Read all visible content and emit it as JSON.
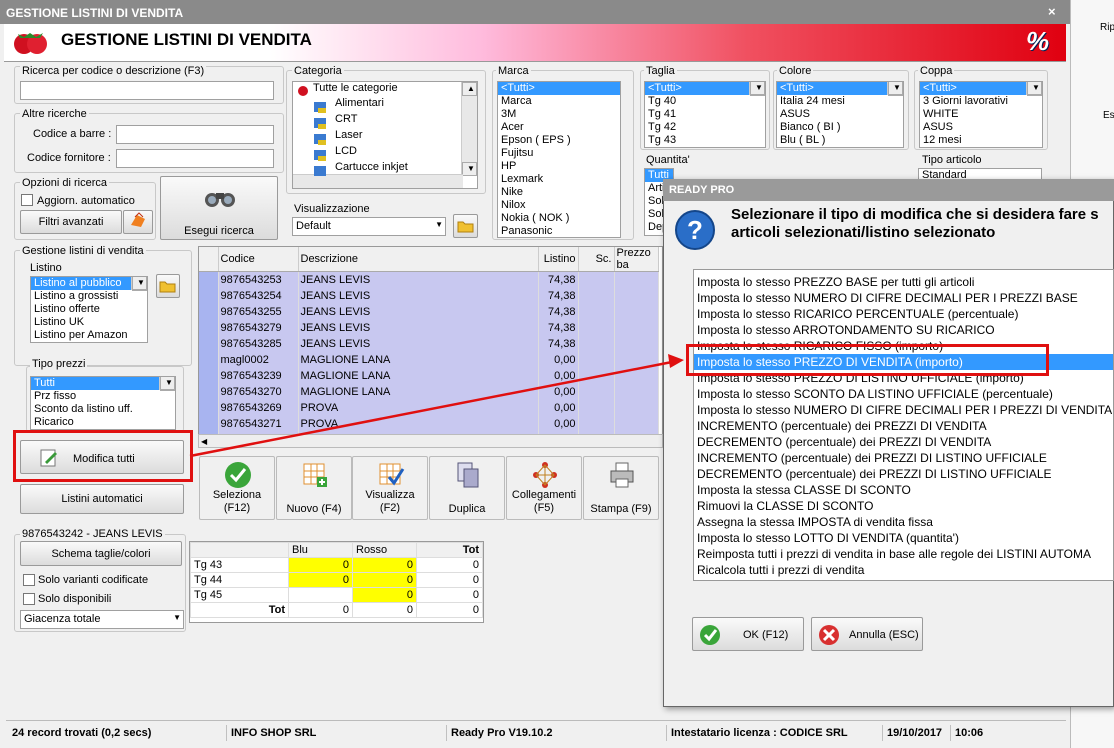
{
  "window": {
    "title": "GESTIONE LISTINI DI VENDITA",
    "banner_title": "GESTIONE LISTINI DI VENDITA",
    "banner_badge": "%",
    "close": "×"
  },
  "right_pane": {
    "text1": "Rip",
    "text2": "Es"
  },
  "search": {
    "label_code_desc": "Ricerca per codice o descrizione (F3)",
    "code_desc_value": "",
    "other_label": "Altre ricerche",
    "barcode_label": "Codice a barre :",
    "supplier_label": "Codice fornitore :",
    "options_label": "Opzioni di ricerca",
    "auto_update_label": "Aggiorn. automatico",
    "advanced_filters_label": "Filtri avanzati",
    "execute_label": "Esegui ricerca"
  },
  "category": {
    "label": "Categoria",
    "items": [
      "Tutte le categorie",
      "Alimentari",
      "CRT",
      "Laser",
      "LCD",
      "Cartucce inkjet"
    ]
  },
  "view": {
    "label": "Visualizzazione",
    "value": "Default"
  },
  "brand": {
    "label": "Marca",
    "items": [
      "<Tutti>",
      "Marca",
      "3M",
      "Acer",
      "Epson ( EPS )",
      "Fujitsu",
      "HP",
      "Lexmark",
      "Nike",
      "Nilox",
      "Nokia ( NOK )",
      "Panasonic"
    ]
  },
  "size": {
    "label": "Taglia",
    "items": [
      "<Tutti>",
      "Tg 40",
      "Tg 41",
      "Tg 42",
      "Tg 43"
    ]
  },
  "color": {
    "label": "Colore",
    "items": [
      "<Tutti>",
      "Italia 24 mesi",
      "ASUS",
      "Bianco ( BI )",
      "Blu ( BL )"
    ]
  },
  "cup": {
    "label": "Coppa",
    "items": [
      "<Tutti>",
      "3 Giorni lavorativi",
      "WHITE",
      "ASUS",
      "12 mesi"
    ]
  },
  "quantity": {
    "label": "Quantita'",
    "items": [
      "Tutti",
      "Arti",
      "Solo",
      "Solo",
      "Dep"
    ]
  },
  "article_type": {
    "label": "Tipo articolo",
    "value": "Standard"
  },
  "price_lists": {
    "group_label": "Gestione listini di vendita",
    "label": "Listino",
    "items": [
      "Listino al pubblico",
      "Listino a grossisti",
      "Listino offerte",
      "Listino UK",
      "Listino per Amazon"
    ]
  },
  "price_types": {
    "label": "Tipo prezzi",
    "items": [
      "Tutti",
      "Prz fisso",
      "Sconto da listino uff.",
      "Ricarico"
    ]
  },
  "modify_all_label": "Modifica tutti",
  "auto_lists_label": "Listini automatici",
  "grid": {
    "columns": [
      "Codice",
      "Descrizione",
      "Listino",
      "Sc.",
      "Prezzo ba"
    ],
    "rows": [
      [
        "9876543253",
        "JEANS LEVIS",
        "74,38"
      ],
      [
        "9876543254",
        "JEANS LEVIS",
        "74,38"
      ],
      [
        "9876543255",
        "JEANS LEVIS",
        "74,38"
      ],
      [
        "9876543279",
        "JEANS LEVIS",
        "74,38"
      ],
      [
        "9876543285",
        "JEANS LEVIS",
        "74,38"
      ],
      [
        "magl0002",
        "MAGLIONE LANA",
        "0,00"
      ],
      [
        "9876543239",
        "MAGLIONE LANA",
        "0,00"
      ],
      [
        "9876543270",
        "MAGLIONE LANA",
        "0,00"
      ],
      [
        "9876543269",
        "PROVA",
        "0,00"
      ],
      [
        "9876543271",
        "PROVA",
        "0,00"
      ],
      [
        "9876543272",
        "PROVA",
        "0,00"
      ]
    ]
  },
  "toolbar": {
    "select": "Seleziona",
    "select_key": "(F12)",
    "new": "Nuovo (F4)",
    "view": "Visualizza",
    "view_key": "(F2)",
    "duplicate": "Duplica",
    "links": "Collegamenti",
    "links_key": "(F5)",
    "print": "Stampa (F9)"
  },
  "variants": {
    "article_label": "9876543242 - JEANS LEVIS",
    "schema_label": "Schema taglie/colori",
    "only_coded": "Solo varianti codificate",
    "only_available": "Solo disponibili",
    "stock_value": "Giacenza totale",
    "headers": [
      "",
      "Blu",
      "Rosso",
      "Tot"
    ],
    "rows": [
      [
        "Tg 43",
        "0",
        "0",
        "0"
      ],
      [
        "Tg 44",
        "0",
        "0",
        "0"
      ],
      [
        "Tg 45",
        "",
        "0",
        "0"
      ],
      [
        "Tot",
        "0",
        "0",
        "0"
      ]
    ]
  },
  "status": {
    "records": "24 record trovati (0,2 secs)",
    "company": "INFO SHOP SRL",
    "version": "Ready Pro V19.10.2",
    "license": "Intestatario licenza : CODICE SRL",
    "date": "19/10/2017",
    "time": "10:06"
  },
  "dialog": {
    "title": "READY PRO",
    "message": "Selezionare il tipo di modifica che si desidera fare s\narticoli selezionati/listino selezionato",
    "options": [
      "Imposta lo stesso PREZZO BASE per tutti gli articoli",
      "Imposta lo stesso NUMERO DI CIFRE DECIMALI PER I PREZZI BASE",
      "Imposta lo stesso RICARICO PERCENTUALE (percentuale)",
      "Imposta lo stesso ARROTONDAMENTO SU RICARICO",
      "Imposta lo stesso RICARICO FISSO (importo)",
      "Imposta lo stesso PREZZO DI VENDITA (importo)",
      "Imposta lo stesso PREZZO DI LISTINO UFFICIALE (importo)",
      "Imposta lo stesso SCONTO DA LISTINO UFFICIALE (percentuale)",
      "Imposta lo stesso NUMERO DI CIFRE DECIMALI PER I PREZZI DI VENDITA",
      "INCREMENTO (percentuale) dei PREZZI DI VENDITA",
      "DECREMENTO (percentuale) dei PREZZI DI VENDITA",
      "INCREMENTO (percentuale) dei PREZZI DI LISTINO UFFICIALE",
      "DECREMENTO (percentuale) dei PREZZI DI LISTINO UFFICIALE",
      "Imposta la stessa CLASSE DI SCONTO",
      "Rimuovi la CLASSE DI SCONTO",
      "Assegna la stessa IMPOSTA di vendita fissa",
      "Imposta lo stesso LOTTO DI VENDITA (quantita')",
      "Reimposta tutti i prezzi di vendita in base alle regole dei LISTINI AUTOMA",
      "Ricalcola tutti i prezzi di vendita"
    ],
    "selected_index": 5,
    "ok_label": "OK (F12)",
    "cancel_label": "Annulla (ESC)"
  },
  "colors": {
    "selection": "#3399ff",
    "highlight": "#e01010",
    "row_bg": "#c8c8f0",
    "yellow": "#ffff00"
  }
}
